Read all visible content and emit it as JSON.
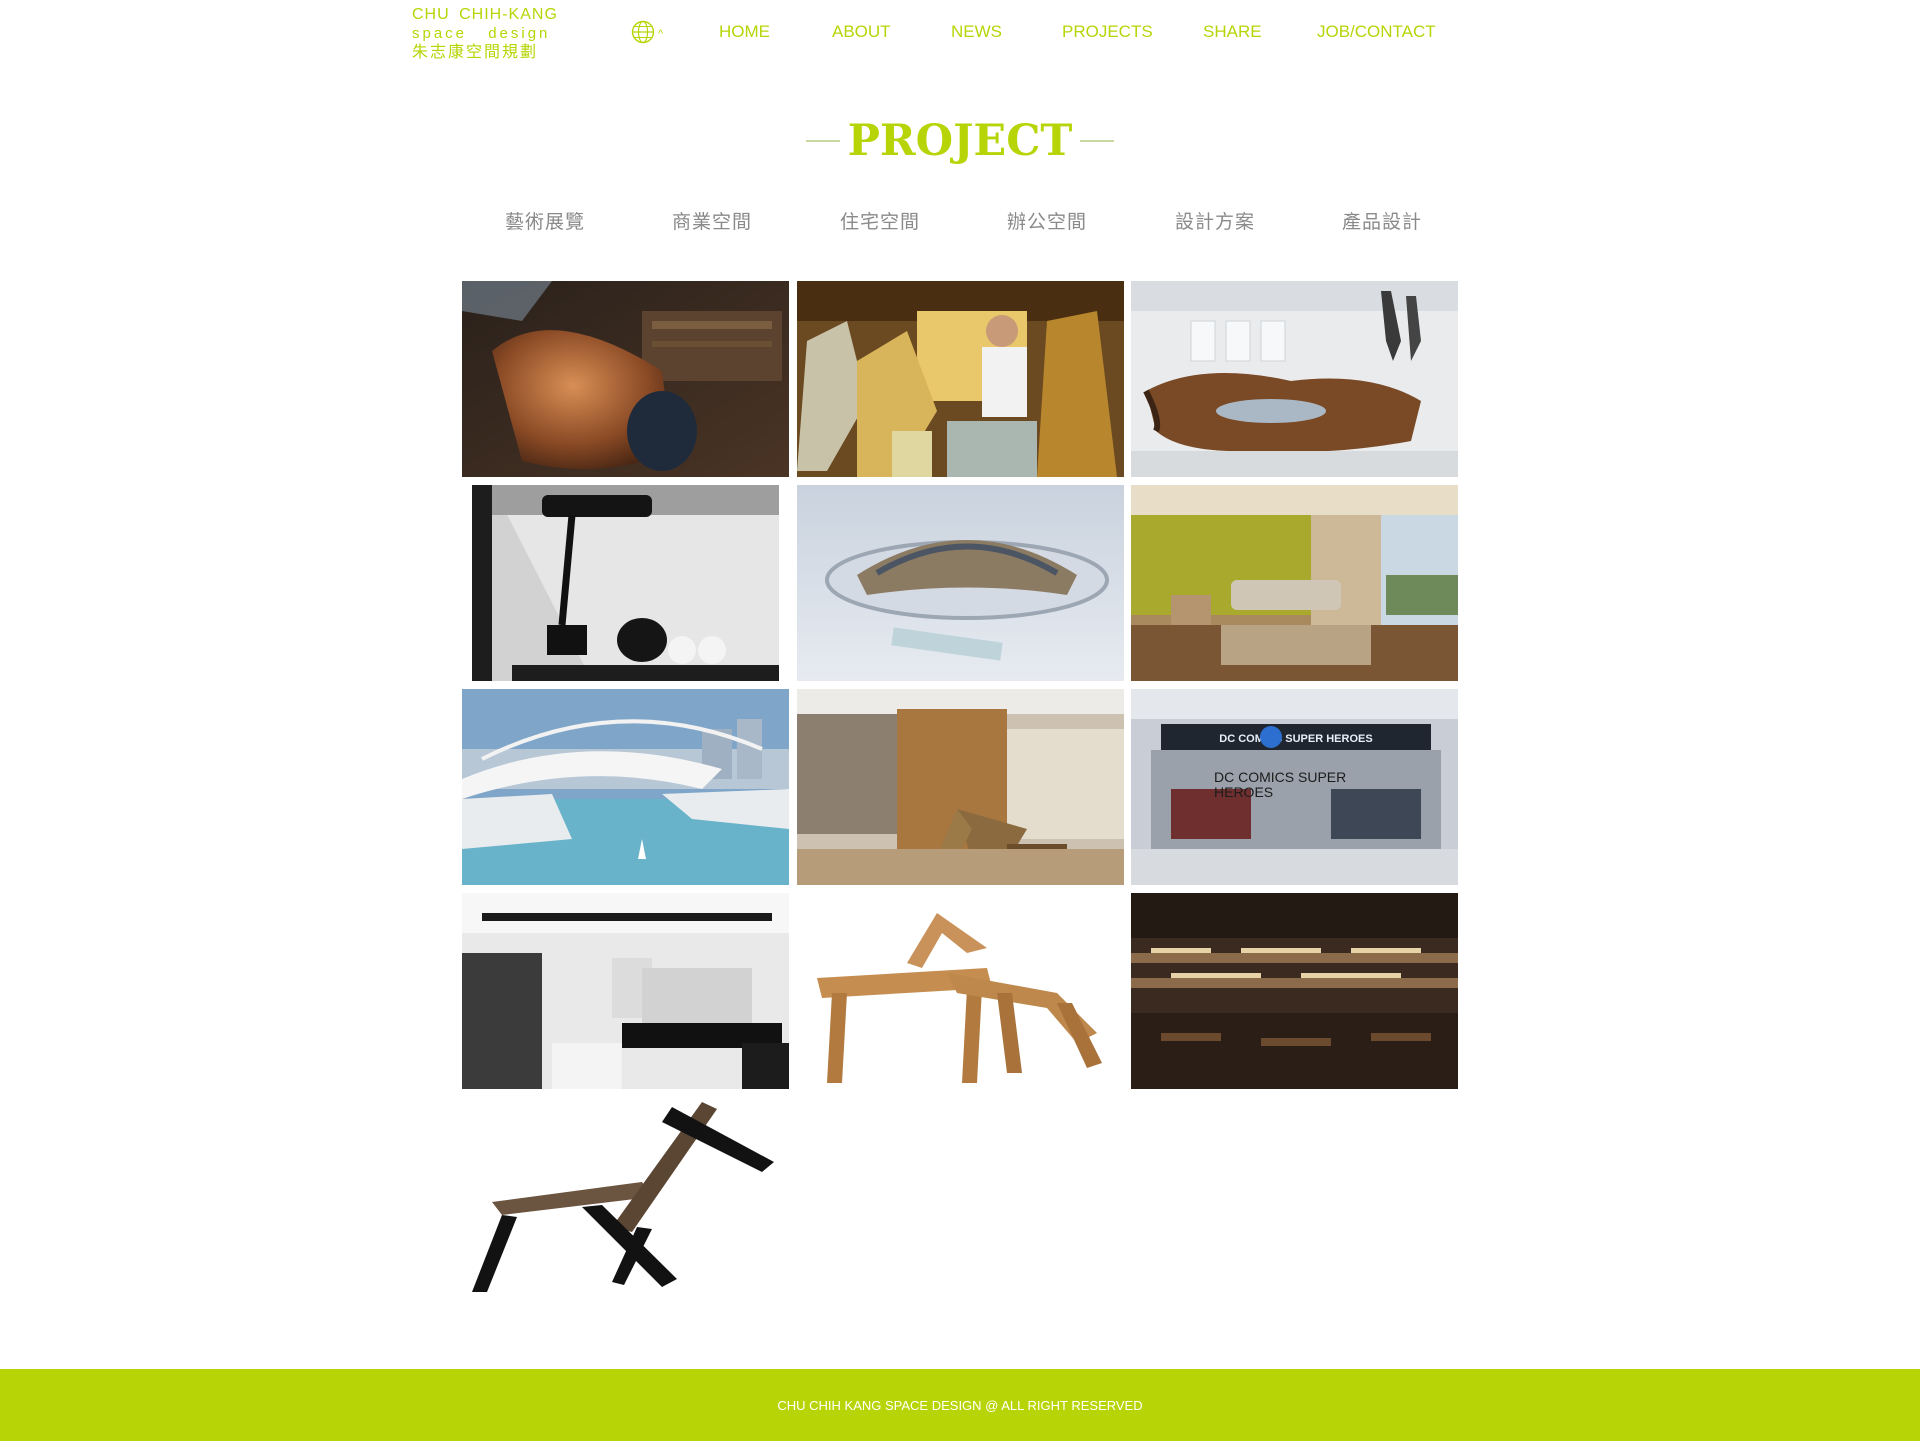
{
  "brand": {
    "name_en": "CHU CHIH-KANG",
    "tagline": "space design",
    "name_zh": "朱志康空間規劃",
    "accent_color": "#b7d506"
  },
  "header": {
    "language_icon": "globe-icon",
    "language_caret": "^"
  },
  "nav": {
    "items": [
      {
        "label": "HOME"
      },
      {
        "label": "ABOUT"
      },
      {
        "label": "NEWS"
      },
      {
        "label": "PROJECTS"
      },
      {
        "label": "SHARE"
      },
      {
        "label": "JOB/CONTACT"
      }
    ]
  },
  "section": {
    "title": "PROJECT"
  },
  "categories": [
    {
      "label": "藝術展覽"
    },
    {
      "label": "商業空間"
    },
    {
      "label": "住宅空間"
    },
    {
      "label": "辦公空間"
    },
    {
      "label": "設計方案"
    },
    {
      "label": "產品設計"
    }
  ],
  "gallery": {
    "items": [
      {
        "image": "copper-sculpture-photo"
      },
      {
        "image": "designer-with-glass-art-photo"
      },
      {
        "image": "rusted-sculpture-gallery-photo"
      },
      {
        "image": "desk-lamp-teapot-photo"
      },
      {
        "image": "snow-pavilion-rendering"
      },
      {
        "image": "living-room-photo"
      },
      {
        "image": "waterfront-architecture-rendering"
      },
      {
        "image": "wood-chair-interior-photo"
      },
      {
        "image": "dc-comics-store-photo",
        "caption": "DC COMICS SUPER HEROES",
        "sign": "DC COMICS  SUPER HEROES"
      },
      {
        "image": "black-white-interior-photo"
      },
      {
        "image": "wooden-chair-stool-photo"
      },
      {
        "image": "bookstore-cafe-photo"
      },
      {
        "image": "reclining-chair-photo"
      }
    ]
  },
  "footer": {
    "text": "CHU CHIH KANG SPACE DESIGN @ ALL RIGHT RESERVED"
  }
}
